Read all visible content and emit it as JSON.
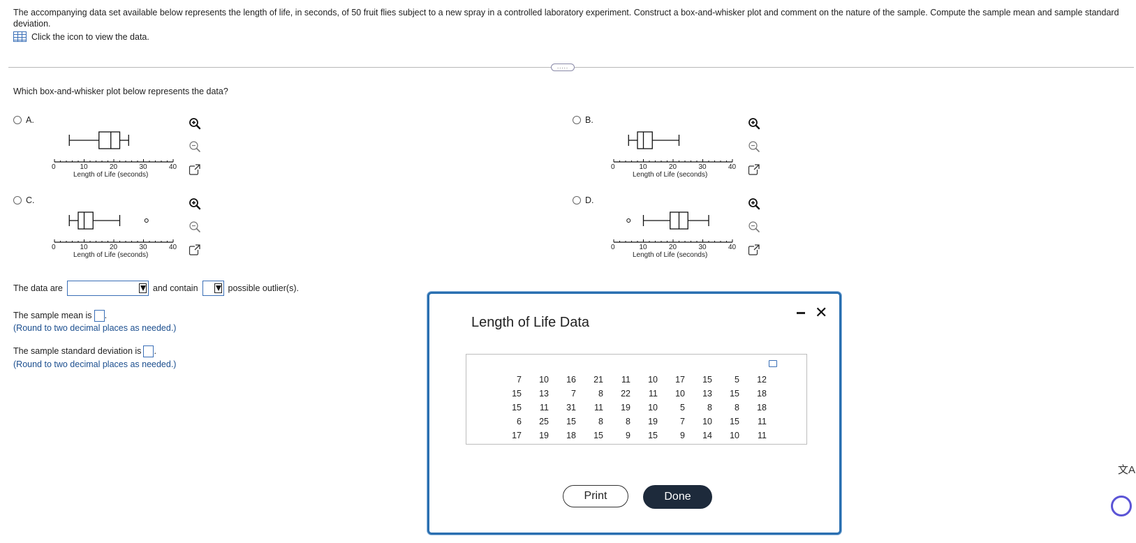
{
  "question": {
    "text": "The accompanying data set available below represents the length of life, in seconds, of 50 fruit flies subject to a new spray in a controlled laboratory experiment. Construct a box-and-whisker plot and comment on the nature of the sample. Compute the sample mean and sample standard deviation.",
    "data_link": "Click the icon to view the data.",
    "more_label": "....."
  },
  "which_question": "Which box-and-whisker plot below represents the data?",
  "axis": {
    "ticks": [
      "0",
      "10",
      "20",
      "30",
      "40"
    ],
    "xlabel": "Length of Life (seconds)"
  },
  "options": [
    {
      "label": "A.",
      "box": {
        "min": 5,
        "q1": 15,
        "median": 19,
        "q3": 22,
        "max": 25,
        "outliers": []
      }
    },
    {
      "label": "B.",
      "box": {
        "min": 5,
        "q1": 8,
        "median": 10,
        "q3": 13,
        "max": 22,
        "outliers": []
      }
    },
    {
      "label": "C.",
      "box": {
        "min": 5,
        "q1": 8,
        "median": 10,
        "q3": 13,
        "max": 22,
        "outliers": [
          31
        ]
      }
    },
    {
      "label": "D.",
      "box": {
        "min": 10,
        "q1": 19,
        "median": 22,
        "q3": 25,
        "max": 32,
        "outliers": [
          5
        ]
      }
    }
  ],
  "plot_icons": [
    "zoom-in-icon",
    "zoom-out-icon",
    "external-link-icon"
  ],
  "answers": {
    "data_are_label": "The data are",
    "and_contain_label": "and contain",
    "possible_outliers_label": "possible outlier(s).",
    "mean_label": "The sample mean is",
    "mean_note": "(Round to two decimal places as needed.)",
    "sd_label": "The sample standard deviation is",
    "sd_note": "(Round to two decimal places as needed.)"
  },
  "dialog": {
    "title": "Length of Life Data",
    "rows": [
      [
        "7",
        "10",
        "16",
        "21",
        "11",
        "10",
        "17",
        "15",
        "5",
        "12"
      ],
      [
        "15",
        "13",
        "7",
        "8",
        "22",
        "11",
        "10",
        "13",
        "15",
        "18"
      ],
      [
        "15",
        "11",
        "31",
        "11",
        "19",
        "10",
        "5",
        "8",
        "8",
        "18"
      ],
      [
        "6",
        "25",
        "15",
        "8",
        "8",
        "19",
        "7",
        "10",
        "15",
        "11"
      ],
      [
        "17",
        "19",
        "18",
        "15",
        "9",
        "15",
        "9",
        "14",
        "10",
        "11"
      ]
    ],
    "print_label": "Print",
    "done_label": "Done",
    "minimize_label": "-",
    "close_label": "✕"
  },
  "side": {
    "translate_label": "文A"
  },
  "colors": {
    "accent": "#3a6fb7",
    "dialog_border": "#2a6fb0",
    "done_bg": "#1d2a3b"
  }
}
